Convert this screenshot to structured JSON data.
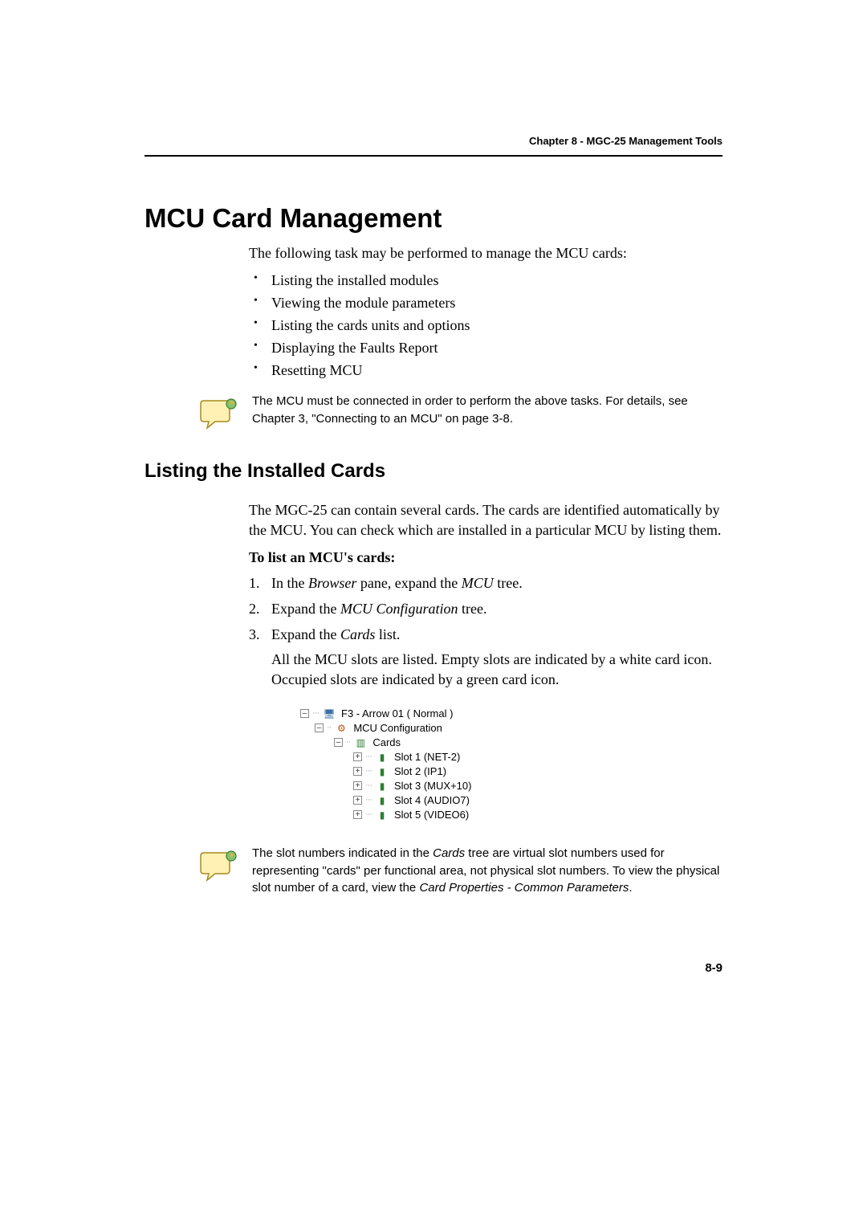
{
  "header": {
    "chapter": "Chapter 8 - MGC-25 Management Tools"
  },
  "title": "MCU Card Management",
  "intro": "The following task may be performed to manage the MCU cards:",
  "bullets": [
    "Listing the installed modules",
    "Viewing the module parameters",
    "Listing the cards units and options",
    "Displaying the Faults Report",
    "Resetting MCU"
  ],
  "note1": "The MCU must be connected in order to perform the above tasks. For details, see Chapter 3, \"Connecting to an MCU\" on page 3-8.",
  "section": {
    "heading": "Listing the Installed Cards",
    "para1": "The MGC-25 can contain several cards. The cards are identified automatically by the MCU. You can check which are installed in a particular MCU by listing them.",
    "lead": "To list an MCU's cards:",
    "steps": {
      "s1_pre": "In the ",
      "s1_it1": "Browser",
      "s1_mid": " pane, expand the ",
      "s1_it2": "MCU",
      "s1_post": " tree.",
      "s2_pre": "Expand the ",
      "s2_it": "MCU Configuration",
      "s2_post": " tree.",
      "s3_pre": "Expand the ",
      "s3_it": "Cards",
      "s3_post": " list.",
      "s3_sub": "All the MCU slots are listed. Empty slots are indicated by a white card icon. Occupied slots are indicated by a green card icon."
    }
  },
  "tree": {
    "root": "F3 - Arrow 01   ( Normal )",
    "config": "MCU Configuration",
    "cards": "Cards",
    "slots": [
      "Slot  1  (NET-2)",
      "Slot  2  (IP1)",
      "Slot  3  (MUX+10)",
      "Slot  4  (AUDIO7)",
      "Slot  5  (VIDEO6)"
    ]
  },
  "note2_pre": "The slot numbers indicated in the ",
  "note2_it1": "Cards",
  "note2_mid": " tree are virtual slot numbers used for representing \"cards\" per functional area, not physical slot numbers. To view the physical slot number of a card, view the ",
  "note2_it2": "Card Properties - Common Parameters",
  "note2_post": ".",
  "pagenum": "8-9"
}
